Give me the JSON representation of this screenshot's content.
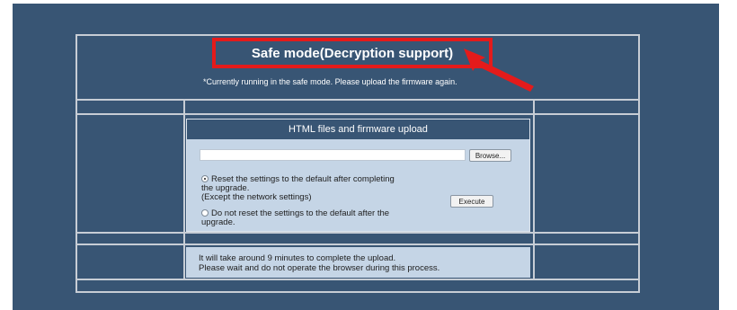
{
  "header": {
    "title": "Safe mode(Decryption support)",
    "subtitle": "*Currently running in the safe mode. Please upload the firmware again."
  },
  "upload_panel": {
    "heading": "HTML files and firmware upload",
    "file_input_value": "",
    "browse_label": "Browse...",
    "execute_label": "Execute",
    "option_reset_line1": "Reset the settings to the default after completing",
    "option_reset_line2": "the upgrade.",
    "option_reset_line3": "(Except the network settings)",
    "option_reset_selected": true,
    "option_keep_line1": "Do not reset the settings to the default after the",
    "option_keep_line2": "upgrade."
  },
  "notice": {
    "line1": "It will take around 9 minutes to complete the upload.",
    "line2": "Please wait and do not operate the browser during this process."
  },
  "colors": {
    "background": "#385574",
    "panel": "#c5d5e6",
    "highlight": "#e41b1b"
  }
}
